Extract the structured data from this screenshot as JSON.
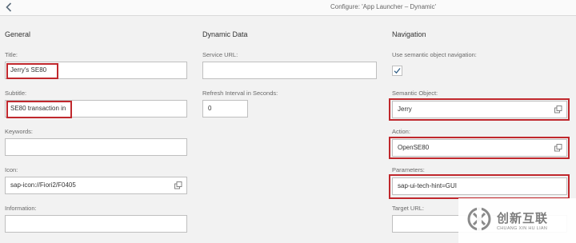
{
  "header": {
    "title": "Configure: 'App Launcher – Dynamic'",
    "back_icon": "chevron-left-icon"
  },
  "general": {
    "title": "General",
    "fields": {
      "title_label": "Title:",
      "title_value": "Jerry's SE80",
      "subtitle_label": "Subtitle:",
      "subtitle_value": "SE80 transaction in",
      "keywords_label": "Keywords:",
      "keywords_value": "",
      "icon_label": "Icon:",
      "icon_value": "sap-icon://Fiori2/F0405",
      "information_label": "Information:",
      "information_value": ""
    }
  },
  "dynamic": {
    "title": "Dynamic Data",
    "fields": {
      "service_url_label": "Service URL:",
      "service_url_value": "",
      "refresh_label": "Refresh Interval in Seconds:",
      "refresh_value": "0"
    }
  },
  "navigation": {
    "title": "Navigation",
    "fields": {
      "semantic_nav_label": "Use semantic object navigation:",
      "semantic_nav_checked": true,
      "semantic_object_label": "Semantic Object:",
      "semantic_object_value": "Jerry",
      "action_label": "Action:",
      "action_value": "OpenSE80",
      "parameters_label": "Parameters:",
      "parameters_value": "sap-ui-tech-hint=GUI",
      "target_url_label": "Target URL:"
    }
  },
  "watermark": {
    "text_cn": "创新互联",
    "text_en": "CHUANG XIN HU LIAN"
  },
  "colors": {
    "highlight": "#c0282d",
    "background": "#f2f2f2",
    "input_border": "#bfbfbf",
    "check": "#346187"
  }
}
